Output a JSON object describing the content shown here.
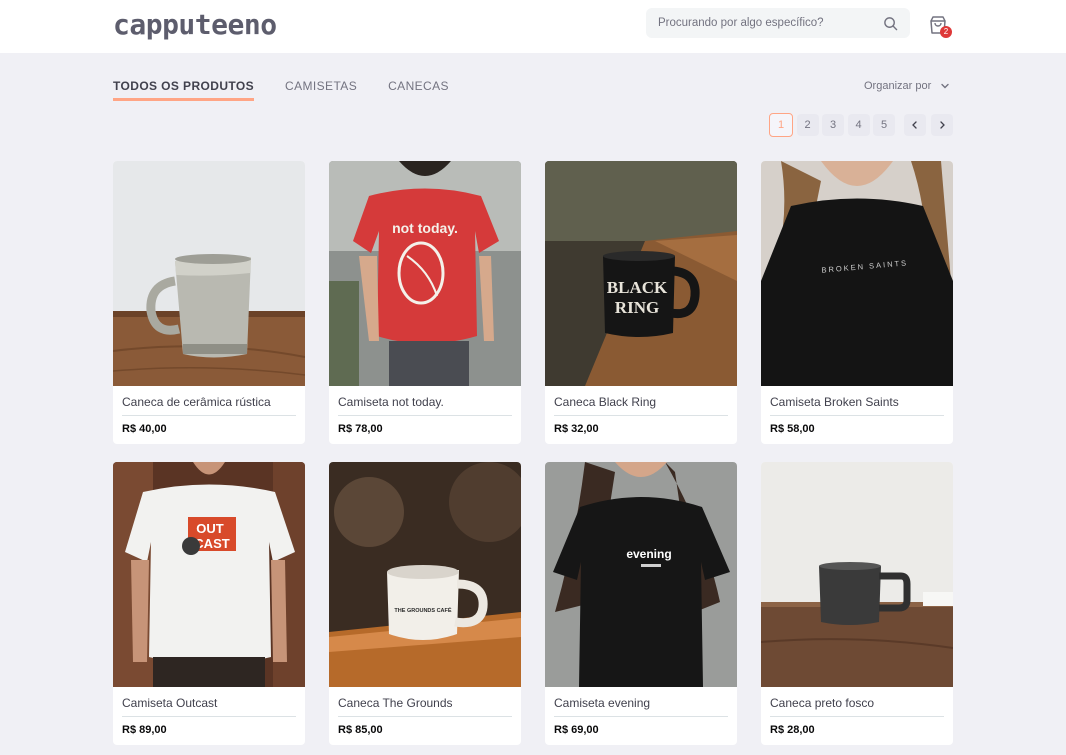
{
  "header": {
    "logo": "capputeeno",
    "search_placeholder": "Procurando por algo específico?",
    "cart_count": "2"
  },
  "tabs": [
    {
      "label": "TODOS OS PRODUTOS",
      "active": true
    },
    {
      "label": "CAMISETAS",
      "active": false
    },
    {
      "label": "CANECAS",
      "active": false
    }
  ],
  "sort": {
    "label": "Organizar por"
  },
  "pagination": {
    "pages": [
      "1",
      "2",
      "3",
      "4",
      "5"
    ],
    "current": "1"
  },
  "products": [
    {
      "name": "Caneca de cerâmica rústica",
      "price": "R$ 40,00",
      "image": "rustic-ceramic-mug"
    },
    {
      "name": "Camiseta not today.",
      "price": "R$ 78,00",
      "image": "red-tshirt"
    },
    {
      "name": "Caneca Black Ring",
      "price": "R$ 32,00",
      "image": "black-mug"
    },
    {
      "name": "Camiseta Broken Saints",
      "price": "R$ 58,00",
      "image": "black-tshirt"
    },
    {
      "name": "Camiseta Outcast",
      "price": "R$ 89,00",
      "image": "white-tshirt"
    },
    {
      "name": "Caneca The Grounds",
      "price": "R$ 85,00",
      "image": "white-mug"
    },
    {
      "name": "Camiseta evening",
      "price": "R$ 69,00",
      "image": "black-tshirt-evening"
    },
    {
      "name": "Caneca preto fosco",
      "price": "R$ 28,00",
      "image": "matte-black-mug"
    }
  ],
  "image_text": {
    "not_today": "not today.",
    "black_ring_1": "BLACK",
    "black_ring_2": "RING",
    "broken_saints": "BROKEN SAINTS",
    "outcast_1": "OUT",
    "outcast_2": "CAST",
    "grounds": "THE GROUNDS CAFÉ",
    "evening": "evening"
  },
  "colors": {
    "accent": "#ffa585",
    "badge": "#de3838",
    "background": "#f0f0f5"
  }
}
